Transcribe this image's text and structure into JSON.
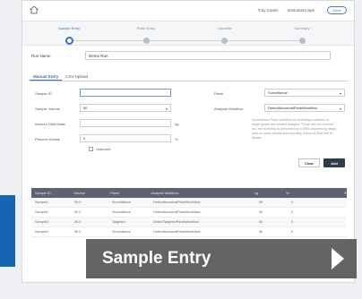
{
  "header": {
    "link_1": "Tray Cases",
    "link_2": "Instrument Spe",
    "done_label": "Done"
  },
  "stepper": {
    "steps": [
      "Sample Entry",
      "Plate Setup",
      "Cassette",
      "Summary"
    ],
    "active_step": 0
  },
  "run": {
    "label": "Run Name",
    "value": "Demo Run"
  },
  "tabs": [
    "Manual Entry",
    "CSV Upload"
  ],
  "form": {
    "sample_id_label": "Sample ID",
    "sample_id_value": "",
    "sample_volume_label": "Sample Volume",
    "sample_volume_value": "50",
    "amount_dna_label": "Amount DNA Mass",
    "amount_dna_value": "",
    "amount_dna_unit": "ng",
    "percent_label": "Percent Volume",
    "percent_value": "0",
    "percent_unit": "%",
    "unknown_label": "Unknown",
    "panel_label": "Panel",
    "panel_value": "Surveillance",
    "analysis_label": "Analysis Workflow",
    "analysis_value": "DetectAbnormalPanelWorkflow",
    "note": "Surveillance Panel workflow for detecting mutations in target genes and related analysis. These are not a preset run, the workflow is performed by a DNA sequencing assay, data on panel results and reporting, follow at DNA link for details.",
    "clear_label": "Clear",
    "add_label": "Add"
  },
  "table": {
    "headers": [
      "Sample ID",
      "Volume",
      "Panel",
      "Analysis Workflow",
      "ng",
      "%",
      "",
      "✕"
    ],
    "rows": [
      [
        "Sample1",
        "50.0",
        "Surveillance",
        "DetectAbnormalPanelWorkflow",
        "50",
        "0"
      ],
      [
        "Sample2",
        "50.0",
        "Surveillance",
        "DetectAbnormalPanelWorkflow",
        "50",
        "0"
      ],
      [
        "Sample3",
        "50.0",
        "Targeted",
        "DetectTargetedPanelWorkflow",
        "50",
        "0"
      ],
      [
        "Sample4",
        "50.0",
        "Surveillance",
        "DetectAbnormalPanelWorkflow",
        "50",
        "0"
      ]
    ]
  },
  "banner": {
    "text": "Sample Entry"
  },
  "colors": {
    "accent": "#3f6fb8",
    "banner_bg": "#4e4e4e",
    "side_bar": "#1565b3"
  }
}
